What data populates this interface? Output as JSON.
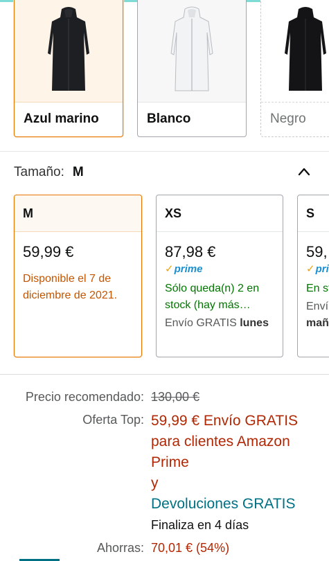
{
  "colors": {
    "items": [
      {
        "label": "Azul marino",
        "selected": true
      },
      {
        "label": "Blanco",
        "selected": false
      },
      {
        "label": "Negro",
        "selected": false
      }
    ]
  },
  "size": {
    "name_label": "Tamaño:",
    "selected_value": "M",
    "cards": [
      {
        "size": "M",
        "price": "59,99 €",
        "availability": "Disponible el 7 de diciembre de 2021."
      },
      {
        "size": "XS",
        "price": "87,98 €",
        "prime_label": "prime",
        "availability": "Sólo queda(n) 2 en stock (hay más…",
        "shipping_prefix": "Envío GRATIS",
        "shipping_day": "lunes"
      },
      {
        "size": "S",
        "price": "59,",
        "prime_label": "pri",
        "availability": "En st",
        "shipping_prefix": "Enví",
        "shipping_day": "mañ"
      }
    ]
  },
  "pricing": {
    "rrp_label": "Precio recomendado:",
    "rrp_value": "130,00 €",
    "offer_label": "Oferta Top:",
    "offer_line1": "59,99 € Envío GRATIS",
    "offer_line2": "para clientes Amazon",
    "offer_line3": "Prime",
    "offer_line4": "y",
    "returns": "Devoluciones GRATIS",
    "ends": "Finaliza en 4 días",
    "savings_label": "Ahorras:",
    "savings_value": "70,01 € (54%)"
  },
  "colors_palette": {
    "selected_border": "#e77600",
    "price_red": "#b12704",
    "link_teal": "#007185",
    "in_stock_green": "#007600",
    "delivery_orange": "#c45500",
    "prime_blue": "#1b8fd0"
  }
}
